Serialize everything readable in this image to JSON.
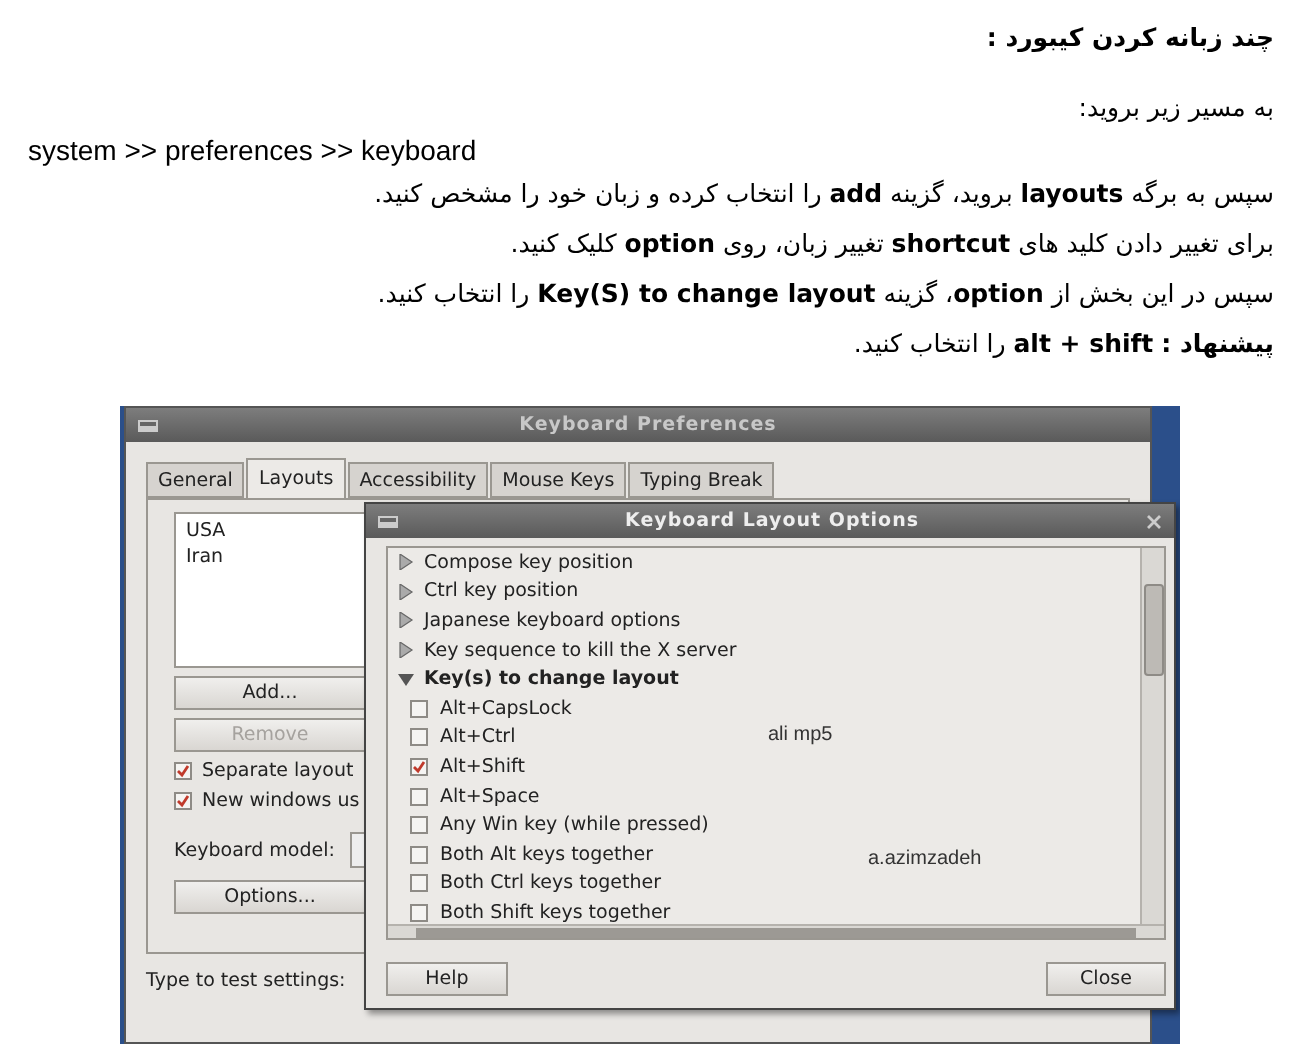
{
  "document": {
    "heading": "چند زبانه کردن کیبورد :",
    "intro": "به مسیر زیر بروید:",
    "path": "system >> preferences >> keyboard",
    "paragraphs": [
      "سپس به  برگه  **layouts** بروید، گزینه  **add** را انتخاب کرده و زبان خود را مشخص کنید.",
      "برای تغییر دادن کلید های **shortcut** تغییر زبان،  روی **option** کلیک کنید.",
      "سپس در این بخش از **option**، گزینه  **Key(S) to change layout**  را انتخاب کنید.",
      "**پیشنهاد :**  **alt + shift**  را انتخاب کنید."
    ]
  },
  "preferences": {
    "title": "Keyboard Preferences",
    "tabs": [
      {
        "label": "General",
        "selected": false
      },
      {
        "label": "Layouts",
        "selected": true
      },
      {
        "label": "Accessibility",
        "selected": false
      },
      {
        "label": "Mouse Keys",
        "selected": false
      },
      {
        "label": "Typing Break",
        "selected": false
      }
    ],
    "layouts": [
      "USA",
      "Iran"
    ],
    "buttons": [
      {
        "label": "Add...",
        "disabled": false
      },
      {
        "label": "Remove",
        "disabled": true
      }
    ],
    "checkboxes": [
      {
        "label": "Separate layout",
        "checked": true
      },
      {
        "label": "New windows us",
        "checked": true
      }
    ],
    "model_label": "Keyboard model:",
    "options_button": "Options...",
    "test_label": "Type to test settings:"
  },
  "dialog": {
    "title": "Keyboard Layout Options",
    "tree": [
      {
        "label": "Compose key position",
        "expanded": false
      },
      {
        "label": "Ctrl key position",
        "expanded": false
      },
      {
        "label": "Japanese keyboard options",
        "expanded": false
      },
      {
        "label": "Key sequence to kill the X server",
        "expanded": false
      },
      {
        "label": "Key(s) to change layout",
        "expanded": true,
        "children": [
          {
            "label": "Alt+CapsLock",
            "checked": false
          },
          {
            "label": "Alt+Ctrl",
            "checked": false
          },
          {
            "label": "Alt+Shift",
            "checked": true
          },
          {
            "label": "Alt+Space",
            "checked": false
          },
          {
            "label": "Any Win key (while pressed)",
            "checked": false
          },
          {
            "label": "Both Alt keys together",
            "checked": false
          },
          {
            "label": "Both Ctrl keys together",
            "checked": false
          },
          {
            "label": "Both Shift keys together",
            "checked": false
          }
        ]
      }
    ],
    "annotations": [
      "ali mp5",
      "a.azimzadeh"
    ],
    "help_button": "Help",
    "close_button": "Close"
  }
}
